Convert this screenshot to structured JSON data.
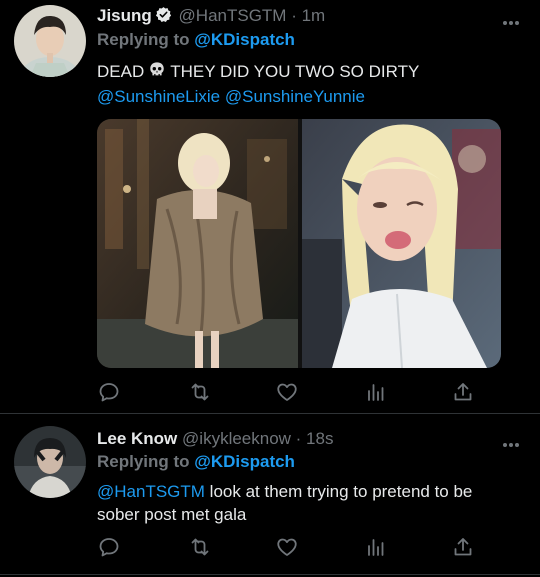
{
  "tweets": [
    {
      "name": "Jisung",
      "handle": "@HanTSGTM",
      "time": "· 1m",
      "verified": true,
      "reply_prefix": "Replying to",
      "reply_to": "@KDispatch",
      "text_before_icon": "DEAD",
      "text_after_icon": "THEY DID YOU TWO SO DIRTY",
      "mentions": [
        "@SunshineLixie",
        "@SunshineYunnie"
      ],
      "icons": [
        "skull-icon",
        "verified-badge-icon"
      ]
    },
    {
      "name": "Lee Know",
      "handle": "@ikykleeknow",
      "time": "· 18s",
      "reply_prefix": "Replying to",
      "reply_to": "@KDispatch",
      "mention": "@HanTSGTM",
      "text_line1": "look at them trying to pretend to be",
      "text_line2": "sober post met gala"
    }
  ],
  "action_icons": [
    "reply-icon",
    "retweet-icon",
    "like-icon",
    "views-icon",
    "share-icon"
  ],
  "colors": {
    "background": "#000000",
    "text": "#e7e9ea",
    "secondary": "#71767b",
    "accent": "#1d9bf0",
    "divider": "#2f3336"
  }
}
